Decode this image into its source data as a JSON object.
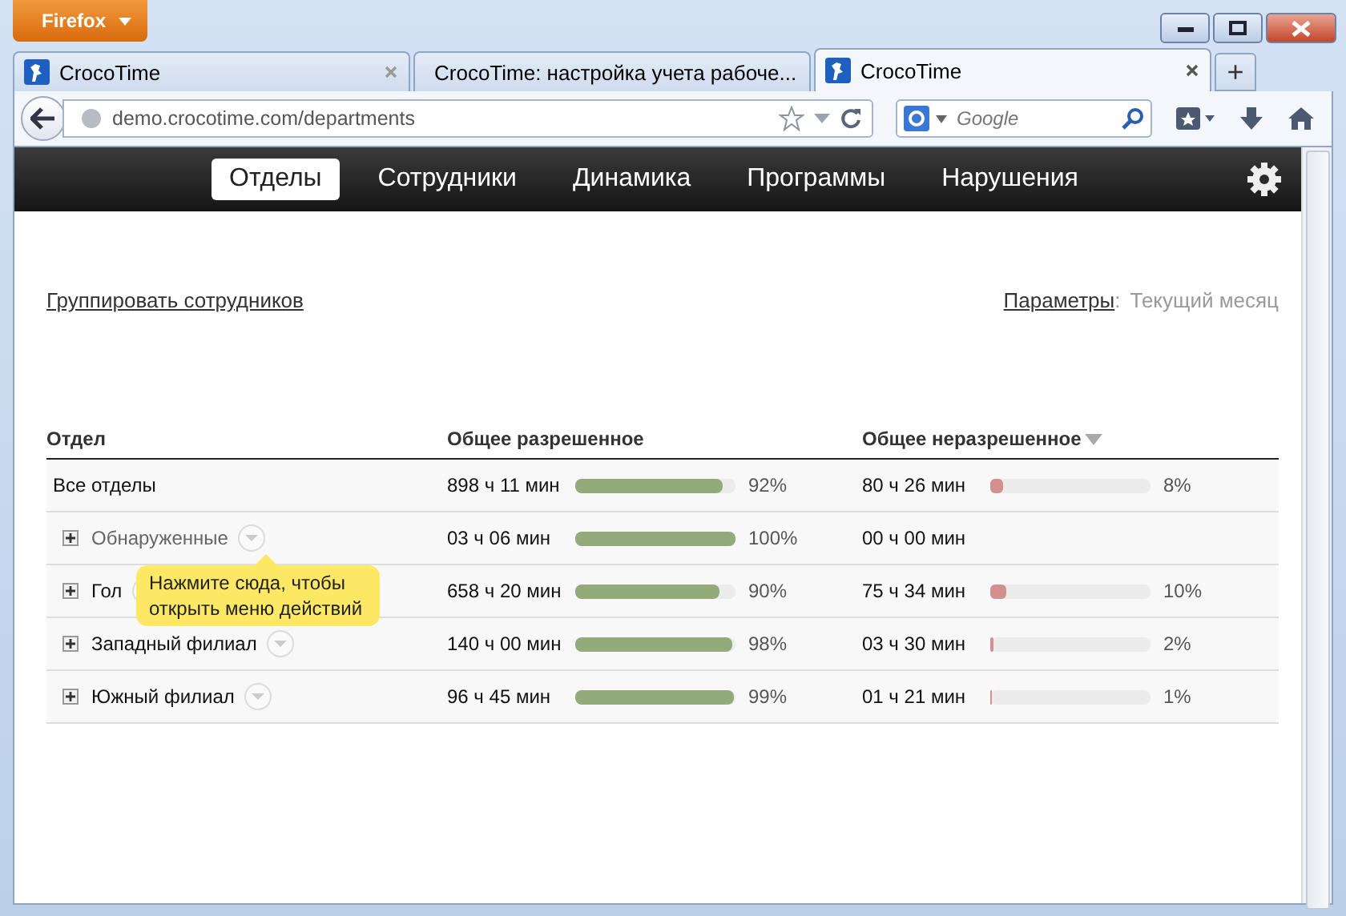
{
  "browser": {
    "menu_button": "Firefox",
    "tabs": [
      {
        "title": "CrocoTime",
        "selected": false
      },
      {
        "title": "CrocoTime: настройка учета рабоче...",
        "selected": false
      },
      {
        "title": "CrocoTime",
        "selected": true
      }
    ],
    "new_tab": "+",
    "url": "demo.crocotime.com/departments",
    "search": {
      "placeholder": "Google"
    }
  },
  "app_nav": {
    "items": [
      {
        "label": "Отделы",
        "selected": true
      },
      {
        "label": "Сотрудники",
        "selected": false
      },
      {
        "label": "Динамика",
        "selected": false
      },
      {
        "label": "Программы",
        "selected": false
      },
      {
        "label": "Нарушения",
        "selected": false
      }
    ]
  },
  "toolbar": {
    "group_link": "Группировать сотрудников",
    "params_link": "Параметры",
    "params_sep": ":",
    "period": "Текущий месяц"
  },
  "table": {
    "columns": [
      {
        "label": "Отдел",
        "sorted": false
      },
      {
        "label": "Общее разрешенное",
        "sorted": false
      },
      {
        "label": "Общее неразрешенное",
        "sorted": true
      }
    ],
    "rows": [
      {
        "kind": "total",
        "name": "Все отделы",
        "dimmed": false,
        "allowed": "898 ч 11 мин",
        "allowed_bar": {
          "level": 0.92
        },
        "allowed_pct": "92%",
        "unallowed": "80 ч 26 мин",
        "unallowed_bar": {
          "level": 0.08
        },
        "unallowed_pct": "8%"
      },
      {
        "kind": "department",
        "name": "Обнаруженные",
        "dimmed": true,
        "allowed": "03 ч 06 мин",
        "allowed_bar": {
          "level": 1.0
        },
        "allowed_pct": "100%",
        "unallowed": "00 ч 00 мин"
      },
      {
        "kind": "department",
        "name": "Гол",
        "dimmed": false,
        "allowed": "658 ч 20 мин",
        "allowed_bar": {
          "level": 0.9
        },
        "allowed_pct": "90%",
        "unallowed": "75 ч 34 мин",
        "unallowed_bar": {
          "level": 0.1
        },
        "unallowed_pct": "10%"
      },
      {
        "kind": "department",
        "name": "Западный филиал",
        "dimmed": false,
        "allowed": "140 ч 00 мин",
        "allowed_bar": {
          "level": 0.98
        },
        "allowed_pct": "98%",
        "unallowed": "03 ч 30 мин",
        "unallowed_bar": {
          "level": 0.02
        },
        "unallowed_pct": "2%"
      },
      {
        "kind": "department",
        "name": "Южный филиал",
        "dimmed": false,
        "allowed": "96 ч 45 мин",
        "allowed_bar": {
          "level": 0.99
        },
        "allowed_pct": "99%",
        "unallowed": "01 ч 21 мин",
        "unallowed_bar": {
          "level": 0.01
        },
        "unallowed_pct": "1%"
      }
    ]
  },
  "tooltip": {
    "text": "Нажмите сюда, чтобы открыть меню действий"
  }
}
